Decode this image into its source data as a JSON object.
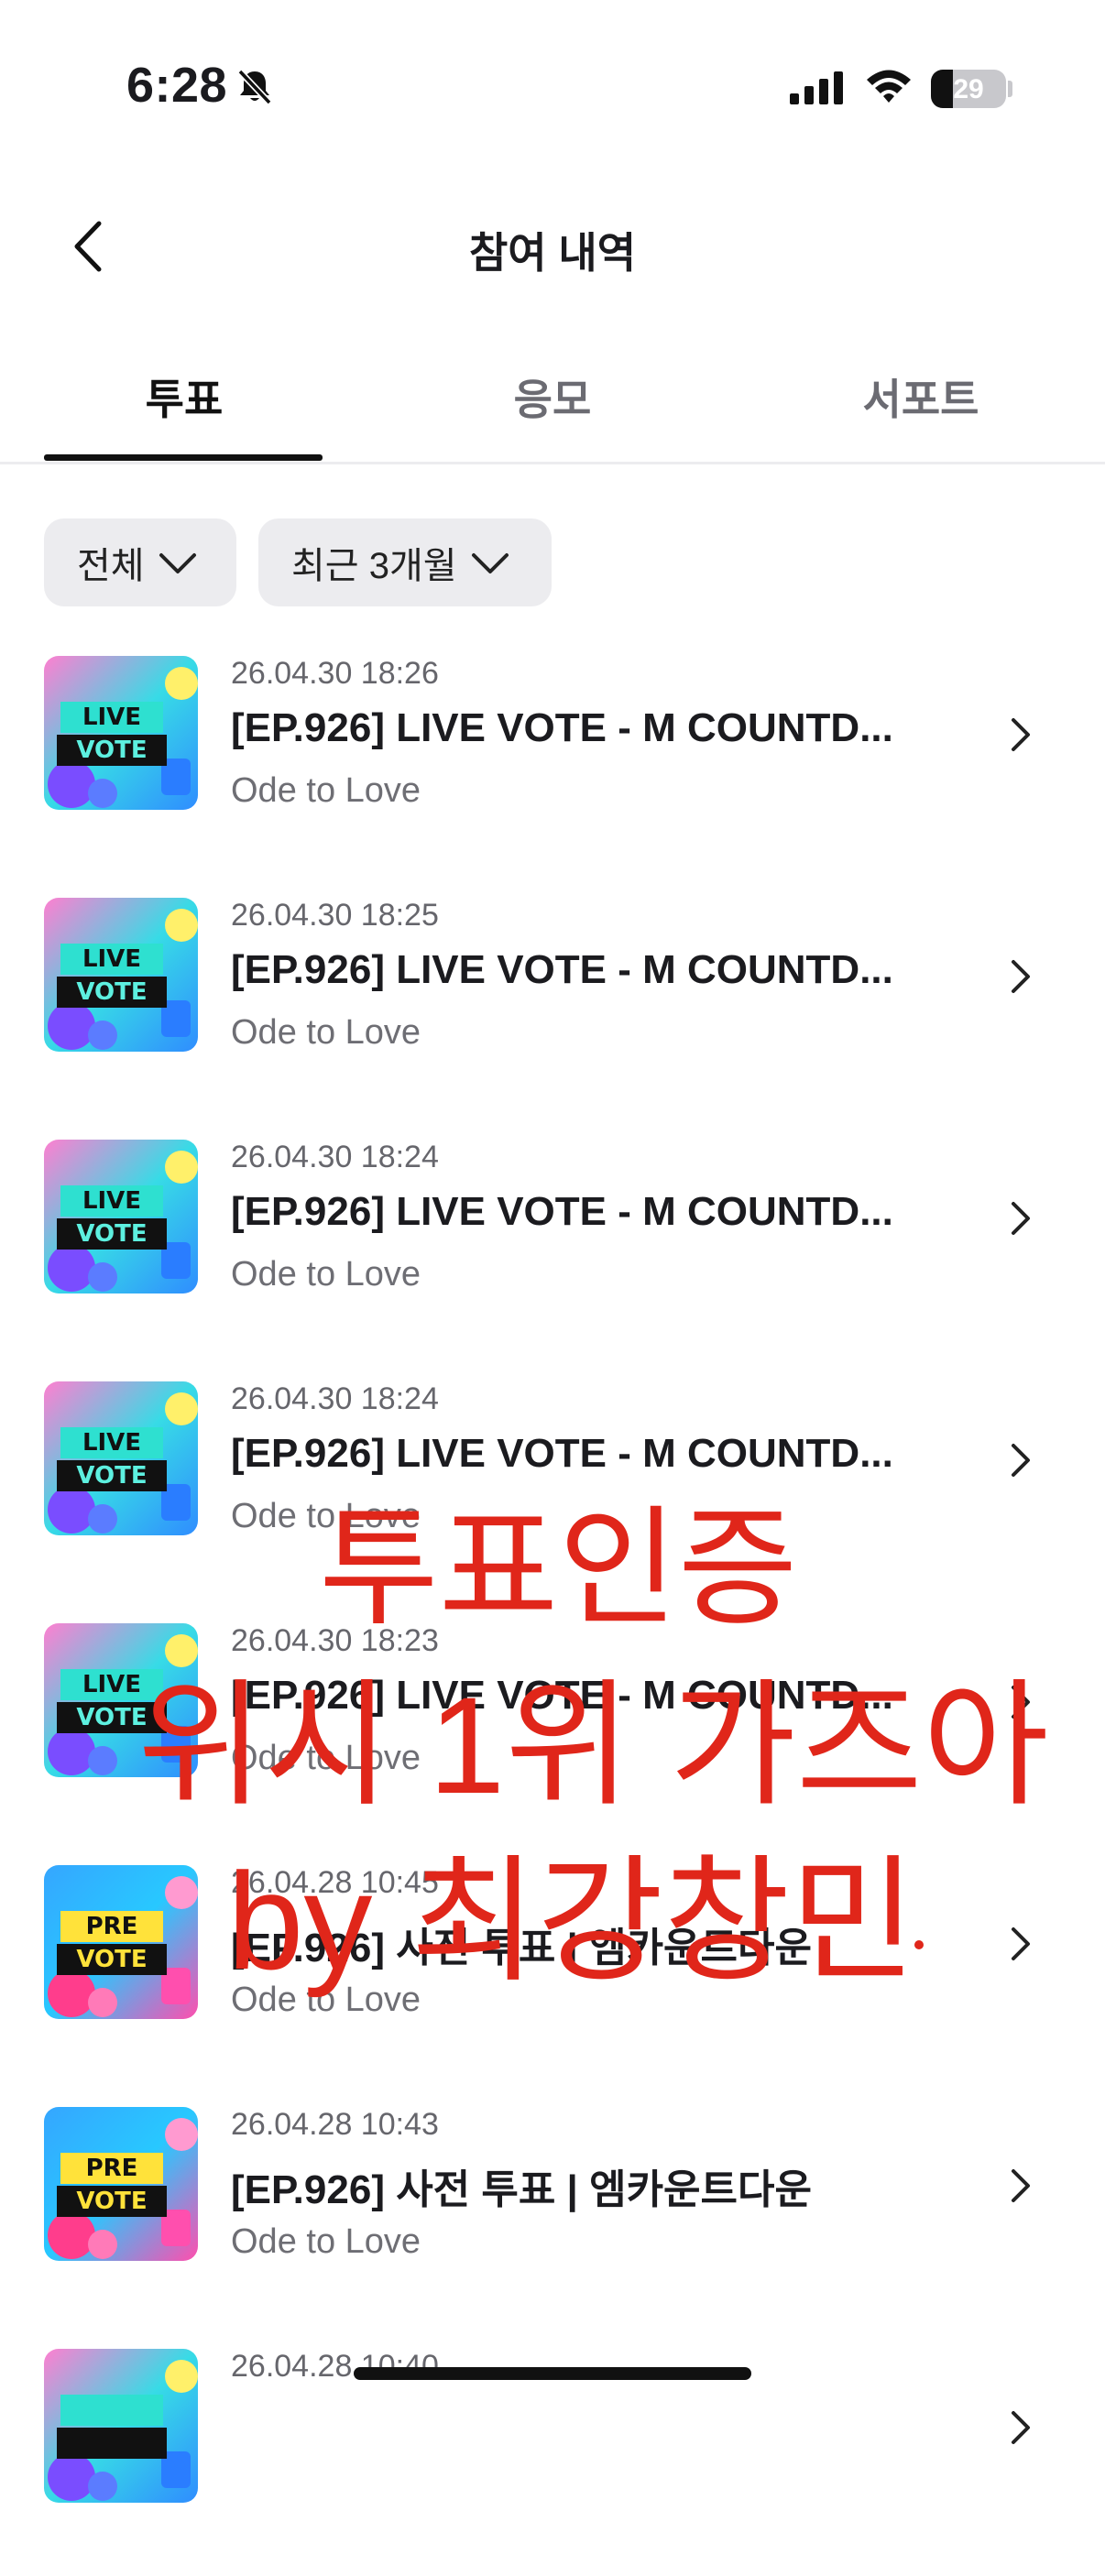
{
  "status_bar": {
    "time": "6:28",
    "battery": "29",
    "battery_level_pct": 29
  },
  "header": {
    "title": "참여 내역"
  },
  "tabs": [
    {
      "label": "투표",
      "active": true
    },
    {
      "label": "응모",
      "active": false
    },
    {
      "label": "서포트",
      "active": false
    }
  ],
  "filters": [
    {
      "label": "전체"
    },
    {
      "label": "최근 3개월"
    }
  ],
  "items": [
    {
      "date": "26.04.30 18:26",
      "title": "[EP.926] LIVE VOTE - M COUNTD...",
      "subtitle": "Ode to Love",
      "thumb_top": "LIVE",
      "thumb_bottom": "VOTE"
    },
    {
      "date": "26.04.30 18:25",
      "title": "[EP.926] LIVE VOTE - M COUNTD...",
      "subtitle": "Ode to Love",
      "thumb_top": "LIVE",
      "thumb_bottom": "VOTE"
    },
    {
      "date": "26.04.30 18:24",
      "title": "[EP.926] LIVE VOTE - M COUNTD...",
      "subtitle": "Ode to Love",
      "thumb_top": "LIVE",
      "thumb_bottom": "VOTE"
    },
    {
      "date": "26.04.30 18:24",
      "title": "[EP.926] LIVE VOTE - M COUNTD...",
      "subtitle": "Ode to Love",
      "thumb_top": "LIVE",
      "thumb_bottom": "VOTE"
    },
    {
      "date": "26.04.30 18:23",
      "title": "[EP.926] LIVE VOTE - M COUNTD...",
      "subtitle": "Ode to Love",
      "thumb_top": "LIVE",
      "thumb_bottom": "VOTE"
    },
    {
      "date": "26.04.28 10:45",
      "title": "[EP.926] 사전 투표 | 엠카운트다운",
      "subtitle": "Ode to Love",
      "thumb_top": "PRE",
      "thumb_bottom": "VOTE"
    },
    {
      "date": "26.04.28 10:43",
      "title": "[EP.926] 사전 투표 | 엠카운트다운",
      "subtitle": "Ode to Love",
      "thumb_top": "PRE",
      "thumb_bottom": "VOTE"
    },
    {
      "date": "26.04.28 10:40",
      "title": "",
      "subtitle": "",
      "thumb_top": "",
      "thumb_bottom": ""
    }
  ],
  "overlay": {
    "line1": "투표인증",
    "line2": "위시 1위 가즈아",
    "line3": "by 최강창민",
    "color": "#e0261a"
  },
  "colors": {
    "accent": "#111111",
    "chip_bg": "#ececef",
    "muted_text": "#6e6e74"
  }
}
